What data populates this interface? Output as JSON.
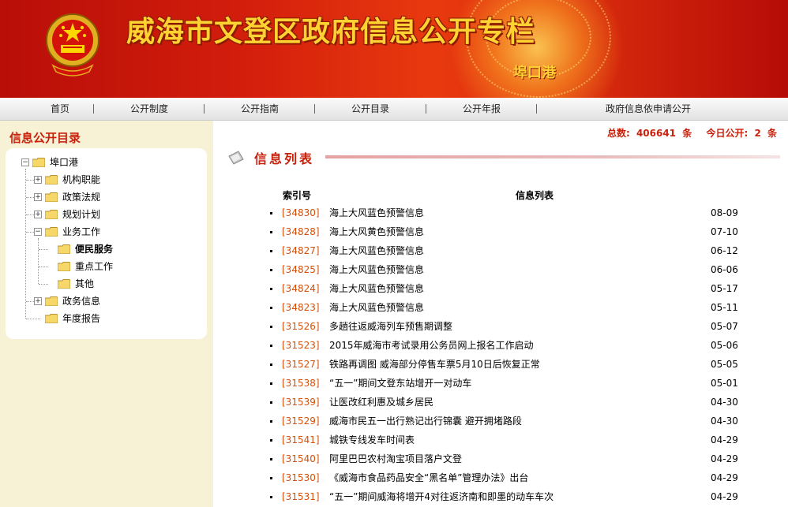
{
  "banner": {
    "title": "威海市文登区政府信息公开专栏",
    "subtitle": "埠口港"
  },
  "nav": {
    "items": [
      "首页",
      "公开制度",
      "公开指南",
      "公开目录",
      "公开年报",
      "政府信息依申请公开"
    ]
  },
  "sidebar": {
    "title": "信息公开目录",
    "tree": [
      {
        "label": "埠口港",
        "toggle": "−"
      },
      {
        "label": "机构职能",
        "toggle": "+"
      },
      {
        "label": "政策法规",
        "toggle": "+"
      },
      {
        "label": "规划计划",
        "toggle": "+"
      },
      {
        "label": "业务工作",
        "toggle": "−"
      },
      {
        "label": "便民服务",
        "toggle": ""
      },
      {
        "label": "重点工作",
        "toggle": ""
      },
      {
        "label": "其他",
        "toggle": ""
      },
      {
        "label": "政务信息",
        "toggle": "+"
      },
      {
        "label": "年度报告",
        "toggle": ""
      }
    ]
  },
  "stats": {
    "total_label": "总数:",
    "total_value": "406641",
    "unit1": "条",
    "today_label": "今日公开:",
    "today_value": "2",
    "unit2": "条"
  },
  "list": {
    "title": "信息列表",
    "col_index": "索引号",
    "col_title": "信息列表",
    "rows": [
      {
        "index": "[34830]",
        "title": "海上大风蓝色预警信息",
        "date": "08-09"
      },
      {
        "index": "[34828]",
        "title": "海上大风黄色预警信息",
        "date": "07-10"
      },
      {
        "index": "[34827]",
        "title": "海上大风蓝色预警信息",
        "date": "06-12"
      },
      {
        "index": "[34825]",
        "title": "海上大风蓝色预警信息",
        "date": "06-06"
      },
      {
        "index": "[34824]",
        "title": "海上大风蓝色预警信息",
        "date": "05-17"
      },
      {
        "index": "[34823]",
        "title": "海上大风蓝色预警信息",
        "date": "05-11"
      },
      {
        "index": "[31526]",
        "title": "多趟往返威海列车预售期调整",
        "date": "05-07"
      },
      {
        "index": "[31523]",
        "title": "2015年威海市考试录用公务员网上报名工作启动",
        "date": "05-06"
      },
      {
        "index": "[31527]",
        "title": "铁路再调图 威海部分停售车票5月10日后恢复正常",
        "date": "05-05"
      },
      {
        "index": "[31538]",
        "title": "“五一”期间文登东站增开一对动车",
        "date": "05-01"
      },
      {
        "index": "[31539]",
        "title": "让医改红利惠及城乡居民",
        "date": "04-30"
      },
      {
        "index": "[31529]",
        "title": "威海市民五一出行熟记出行锦囊 避开拥堵路段",
        "date": "04-30"
      },
      {
        "index": "[31541]",
        "title": "城铁专线发车时间表",
        "date": "04-29"
      },
      {
        "index": "[31540]",
        "title": "阿里巴巴农村淘宝项目落户文登",
        "date": "04-29"
      },
      {
        "index": "[31530]",
        "title": "《威海市食品药品安全“黑名单”管理办法》出台",
        "date": "04-29"
      },
      {
        "index": "[31531]",
        "title": "“五一”期间威海将增开4对往返济南和即墨的动车车次",
        "date": "04-29"
      }
    ]
  }
}
